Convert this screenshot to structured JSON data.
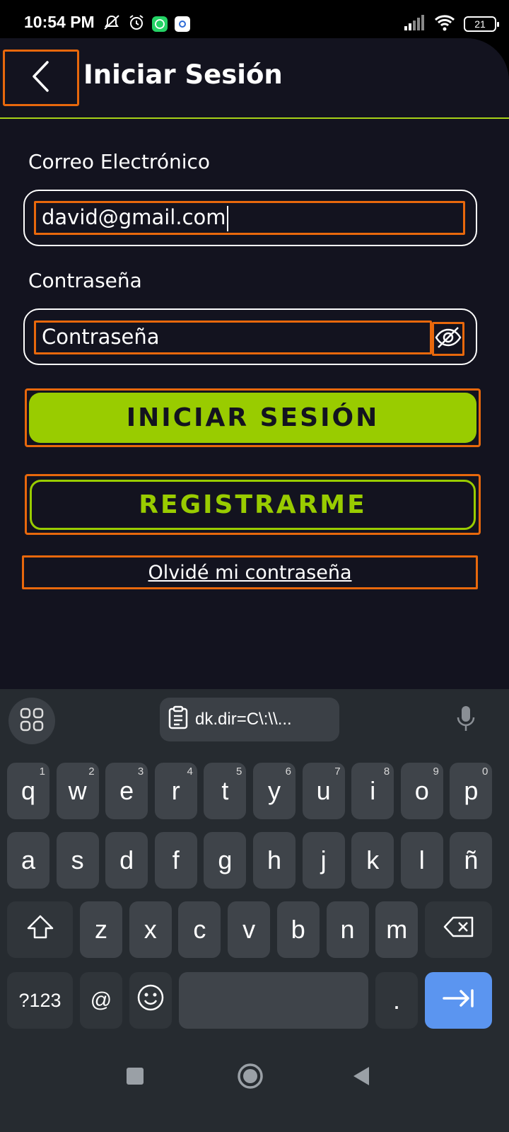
{
  "status_bar": {
    "time": "10:54 PM",
    "battery": "21"
  },
  "header": {
    "title": "Iniciar Sesión"
  },
  "form": {
    "email_label": "Correo Electrónico",
    "email_value": "david@gmail.com",
    "password_label": "Contraseña",
    "password_placeholder": "Contraseña"
  },
  "buttons": {
    "login": "INICIAR SESIÓN",
    "register": "REGISTRARME",
    "forgot": "Olvidé mi contraseña"
  },
  "keyboard": {
    "clipboard_suggestion": "dk.dir=C\\:\\\\...",
    "row1": [
      {
        "k": "q",
        "h": "1"
      },
      {
        "k": "w",
        "h": "2"
      },
      {
        "k": "e",
        "h": "3"
      },
      {
        "k": "r",
        "h": "4"
      },
      {
        "k": "t",
        "h": "5"
      },
      {
        "k": "y",
        "h": "6"
      },
      {
        "k": "u",
        "h": "7"
      },
      {
        "k": "i",
        "h": "8"
      },
      {
        "k": "o",
        "h": "9"
      },
      {
        "k": "p",
        "h": "0"
      }
    ],
    "row2": [
      "a",
      "s",
      "d",
      "f",
      "g",
      "h",
      "j",
      "k",
      "l",
      "ñ"
    ],
    "row3": [
      "z",
      "x",
      "c",
      "v",
      "b",
      "n",
      "m"
    ],
    "symbols_key": "?123",
    "at_key": "@",
    "period_key": "."
  },
  "colors": {
    "accent": "#99cc00",
    "background": "#13131f",
    "highlight": "#e8680c"
  }
}
